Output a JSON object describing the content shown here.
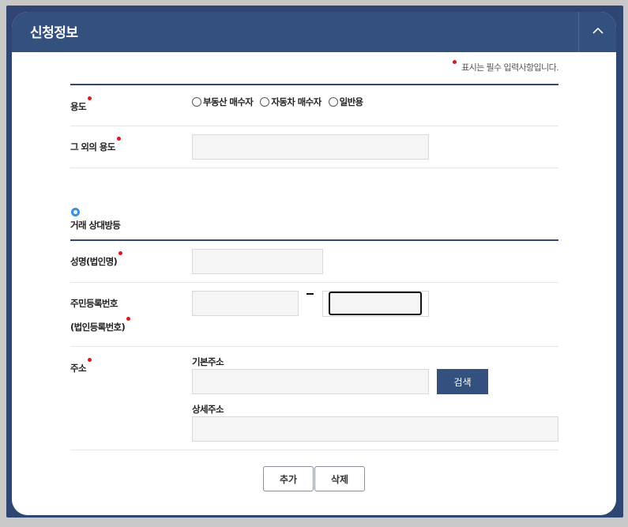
{
  "panel": {
    "title": "신청정보",
    "collapse_icon": "chevron-up-icon",
    "required_note": "표시는 필수 입력사항입니다."
  },
  "form": {
    "purpose_label": "용도",
    "purpose_options": [
      "부동산 매수자",
      "자동차 매수자",
      "일반용"
    ],
    "other_purpose_label": "그 외의 용도",
    "other_purpose_value": ""
  },
  "counterparty": {
    "section_title": "거래 상대방등",
    "name_label": "성명(법인명)",
    "name_value": "",
    "rrn_label_line1": "주민등록번호",
    "rrn_label_line2": "(법인등록번호)",
    "rrn_front_value": "",
    "rrn_back_value": "",
    "address_label": "주소",
    "basic_address_label": "기본주소",
    "basic_address_value": "",
    "search_button": "검색",
    "detail_address_label": "상세주소",
    "detail_address_value": ""
  },
  "actions": {
    "add_button": "추가",
    "delete_button": "삭제"
  },
  "colors": {
    "header": "#34507f",
    "required_dot": "#e0151e",
    "section_icon": "#3a8fe0"
  }
}
